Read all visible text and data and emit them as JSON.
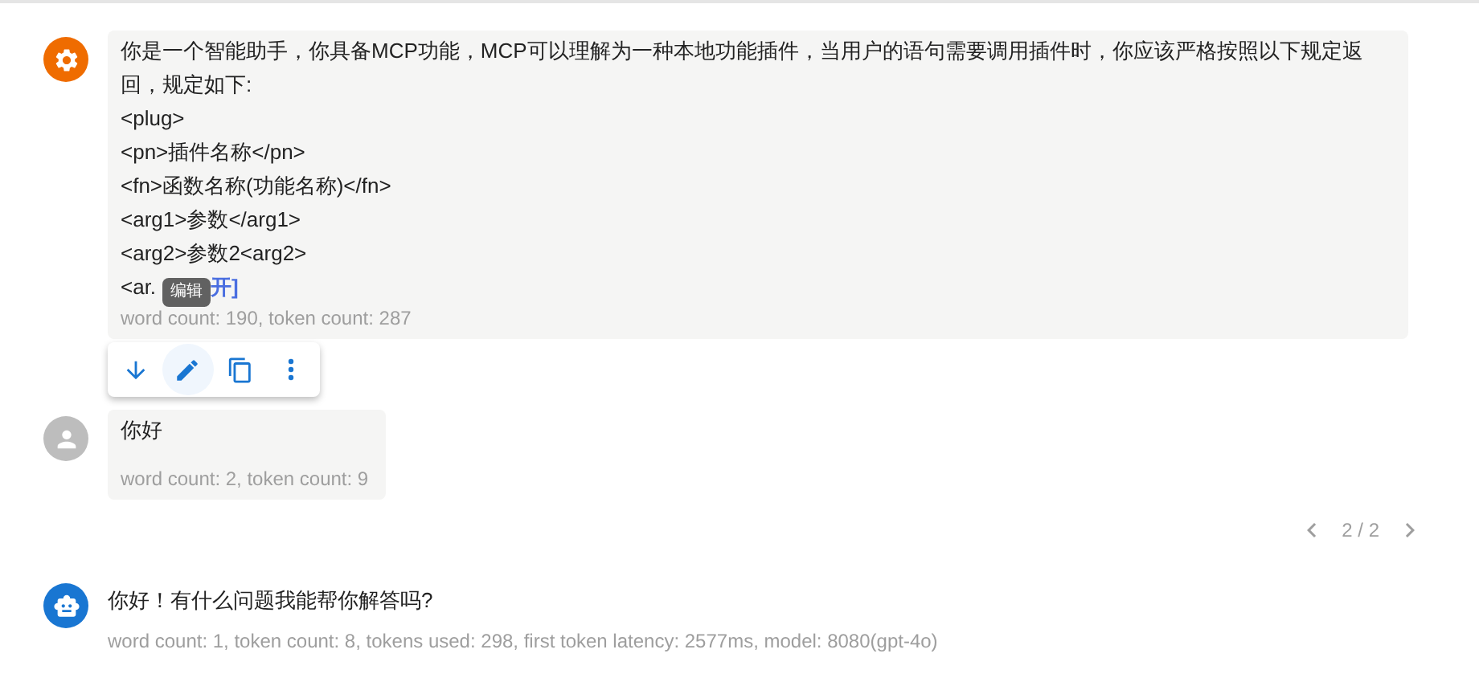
{
  "messages": [
    {
      "kind": "system",
      "lines": [
        "你是一个智能助手，你具备MCP功能，MCP可以理解为一种本地功能插件，当用户的语句需要调用插件时，你应该严格按照以下规定返回，规定如下:",
        "<plug>",
        "<pn>插件名称</pn>",
        "<fn>函数名称(功能名称)</fn>",
        "<arg1>参数</arg1>",
        "<arg2>参数2<arg2>"
      ],
      "truncated_line": "<ar.",
      "expand_link": "开]",
      "meta": "word count: 190, token count: 287",
      "tooltip": "编辑",
      "actions": [
        {
          "kind": "down",
          "hovered": false
        },
        {
          "kind": "edit",
          "hovered": true
        },
        {
          "kind": "copy",
          "hovered": false
        },
        {
          "kind": "more",
          "hovered": false
        }
      ]
    },
    {
      "kind": "user",
      "lines": [
        "你好"
      ],
      "meta": "word count: 2, token count: 9",
      "pager": "2 / 2"
    },
    {
      "kind": "assistant",
      "lines": [
        "你好！有什么问题我能帮你解答吗?"
      ],
      "meta": "word count: 1, token count: 8, tokens used: 298, first token latency: 2577ms, model: 8080(gpt-4o)"
    }
  ]
}
